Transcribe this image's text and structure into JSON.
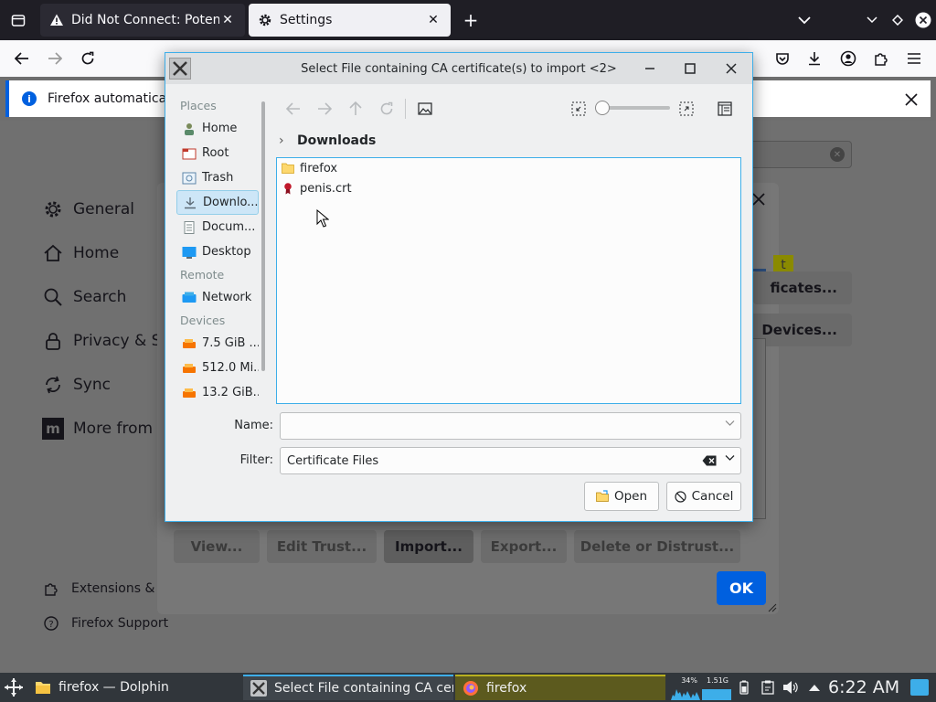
{
  "browser": {
    "tabs": [
      {
        "label": "Did Not Connect: Potential",
        "close": "✕"
      },
      {
        "label": "Settings",
        "close": "✕"
      }
    ],
    "new_tab": "+",
    "notification": "Firefox automatically s"
  },
  "settings": {
    "find_clear": "✕",
    "nav": [
      {
        "label": "General"
      },
      {
        "label": "Home"
      },
      {
        "label": "Search"
      },
      {
        "label": "Privacy & Se"
      },
      {
        "label": "Sync"
      },
      {
        "label": "More from M"
      }
    ],
    "footer_nav": [
      {
        "label": "Extensions & T"
      },
      {
        "label": "Firefox Support"
      }
    ]
  },
  "cert_manager": {
    "partial_right": [
      "t",
      "ficates...",
      "Devices..."
    ],
    "buttons": [
      "View...",
      "Edit Trust...",
      "Import...",
      "Export...",
      "Delete or Distrust..."
    ],
    "ok": "OK"
  },
  "file_dialog": {
    "title": "Select File containing CA certificate(s) to import <2>",
    "places_header": "Places",
    "places": [
      {
        "label": "Home",
        "icon": "home-folder-icon"
      },
      {
        "label": "Root",
        "icon": "root-folder-icon"
      },
      {
        "label": "Trash",
        "icon": "trash-icon"
      },
      {
        "label": "Downlo...",
        "icon": "downloads-icon",
        "selected": true
      },
      {
        "label": "Docum...",
        "icon": "documents-icon"
      },
      {
        "label": "Desktop",
        "icon": "desktop-icon"
      }
    ],
    "remote_header": "Remote",
    "remote": [
      {
        "label": "Network",
        "icon": "network-icon"
      }
    ],
    "devices_header": "Devices",
    "devices": [
      {
        "label": "7.5 GiB ...",
        "icon": "drive-icon"
      },
      {
        "label": "512.0 Mi...",
        "icon": "drive-icon"
      },
      {
        "label": "13.2 GiB...",
        "icon": "drive-icon"
      }
    ],
    "breadcrumb": "Downloads",
    "files": [
      {
        "name": "firefox",
        "type": "folder"
      },
      {
        "name": "penis.crt",
        "type": "certificate"
      }
    ],
    "name_label": "Name:",
    "name_value": "",
    "filter_label": "Filter:",
    "filter_value": "Certificate Files",
    "open_label": "Open",
    "cancel_label": "Cancel"
  },
  "taskbar": {
    "tasks": [
      {
        "label": "firefox — Dolphin"
      },
      {
        "label": "Select File containing CA certific..."
      },
      {
        "label": "firefox"
      }
    ],
    "cpu": "34%",
    "mem": "1.51G",
    "clock": "6:22 AM"
  },
  "colors": {
    "accent": "#0060df",
    "kde_blue": "#3daee9",
    "selection": "#cde6f7"
  }
}
